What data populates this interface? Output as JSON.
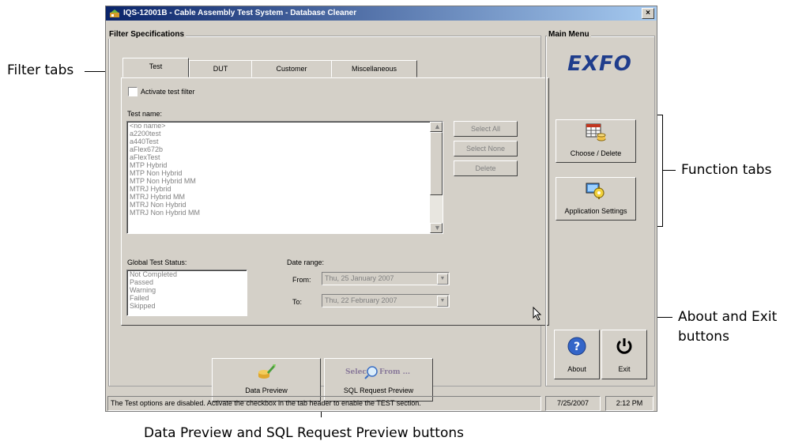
{
  "callouts": {
    "filter_tabs": "Filter tabs",
    "function_tabs": "Function tabs",
    "about_exit_line1": "About and Exit",
    "about_exit_line2": "buttons",
    "preview_buttons": "Data Preview and SQL Request Preview buttons"
  },
  "window": {
    "title": "IQS-12001B - Cable Assembly Test System - Database Cleaner",
    "close_label": "×"
  },
  "filter_specs": {
    "legend": "Filter Specifications",
    "tabs": [
      "Test",
      "DUT",
      "Customer",
      "Miscellaneous"
    ],
    "activate_label": "Activate test filter",
    "test_name_label": "Test name:",
    "test_names": [
      "<no name>",
      "a2200test",
      "a440Test",
      "aFlex672b",
      "aFlexTest",
      "MTP Hybrid",
      "MTP Non Hybrid",
      "MTP Non Hybrid MM",
      "MTRJ Hybrid",
      "MTRJ Hybrid MM",
      "MTRJ Non Hybrid",
      "MTRJ Non Hybrid MM"
    ],
    "select_all": "Select All",
    "select_none": "Select None",
    "delete": "Delete",
    "global_status_label": "Global Test Status:",
    "statuses": [
      "Not Completed",
      "Passed",
      "Warning",
      "Failed",
      "Skipped"
    ],
    "date_range_label": "Date range:",
    "from_label": "From:",
    "to_label": "To:",
    "from_date": "Thu, 25  January  2007",
    "to_date": "Thu, 22  February  2007"
  },
  "preview": {
    "data_preview": "Data Preview",
    "sql_preview": "SQL Request Preview",
    "sql_icon_text_1": "Select",
    "sql_icon_text_2": "From ..."
  },
  "main_menu": {
    "legend": "Main Menu",
    "logo": "EXFO",
    "choose_delete": "Choose / Delete",
    "app_settings": "Application Settings",
    "about": "About",
    "exit": "Exit"
  },
  "status_bar": {
    "message": "The Test options are disabled. Activate the checkbox in the tab header to enable the TEST section.",
    "date": "7/25/2007",
    "time": "2:12 PM"
  },
  "colors": {
    "window_bg": "#d4d0c8",
    "titlebar_start": "#0a246a",
    "titlebar_end": "#a6caf0",
    "logo": "#1f3d8c",
    "about_icon": "#3465c8"
  }
}
